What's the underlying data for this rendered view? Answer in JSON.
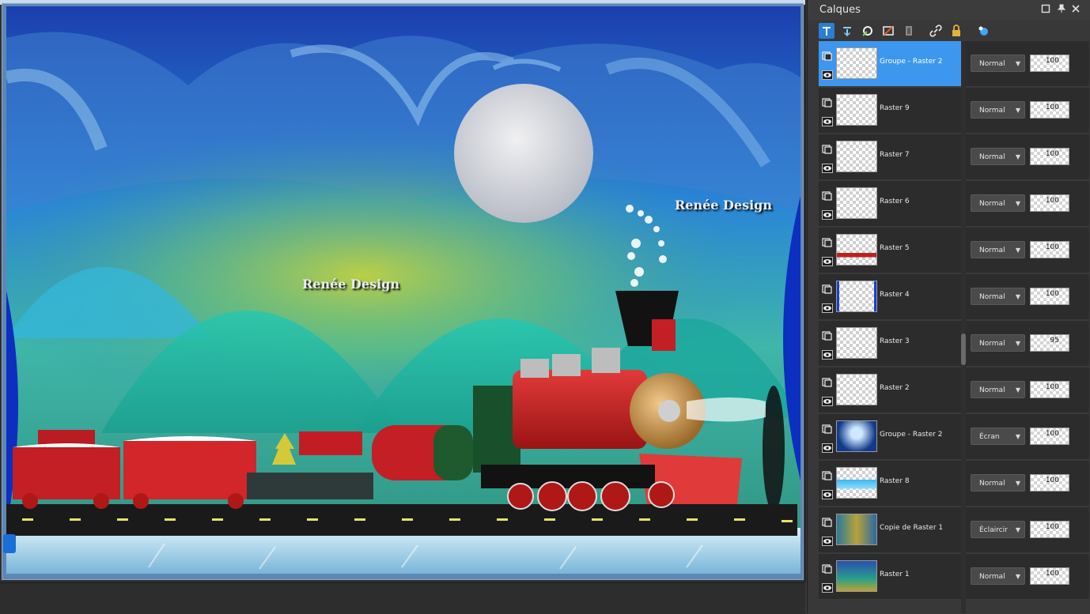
{
  "panel": {
    "title": "Calques",
    "header_buttons": [
      "restore-icon",
      "pin-icon",
      "close-icon"
    ],
    "toolbar_icons": [
      "new-raster-layer-icon",
      "new-vector-layer-icon",
      "new-mask-layer-icon",
      "new-adjustment-layer-icon",
      "delete-layer-icon",
      "link-layers-icon",
      "lock-layer-icon",
      "layer-styles-icon"
    ]
  },
  "watermark_text": "Renée Design",
  "layers": [
    {
      "name": "Groupe - Raster 2",
      "blend": "Normal",
      "opacity": "100",
      "selected": true
    },
    {
      "name": "Raster 9",
      "blend": "Normal",
      "opacity": "100",
      "selected": false
    },
    {
      "name": "Raster 7",
      "blend": "Normal",
      "opacity": "100",
      "selected": false
    },
    {
      "name": "Raster 6",
      "blend": "Normal",
      "opacity": "100",
      "selected": false
    },
    {
      "name": "Raster 5",
      "blend": "Normal",
      "opacity": "100",
      "selected": false
    },
    {
      "name": "Raster 4",
      "blend": "Normal",
      "opacity": "100",
      "selected": false
    },
    {
      "name": "Raster 3",
      "blend": "Normal",
      "opacity": "95",
      "selected": false
    },
    {
      "name": "Raster 2",
      "blend": "Normal",
      "opacity": "100",
      "selected": false
    },
    {
      "name": "Groupe - Raster 2",
      "blend": "Écran",
      "opacity": "100",
      "selected": false
    },
    {
      "name": "Raster 8",
      "blend": "Normal",
      "opacity": "100",
      "selected": false
    },
    {
      "name": "Copie de Raster 1",
      "blend": "Éclaircir",
      "opacity": "100",
      "selected": false
    },
    {
      "name": "Raster 1",
      "blend": "Normal",
      "opacity": "100",
      "selected": false
    }
  ],
  "colors": {
    "selection": "#3d97ee",
    "panel_bg": "#383838",
    "row_bg": "#2c2c2c"
  }
}
